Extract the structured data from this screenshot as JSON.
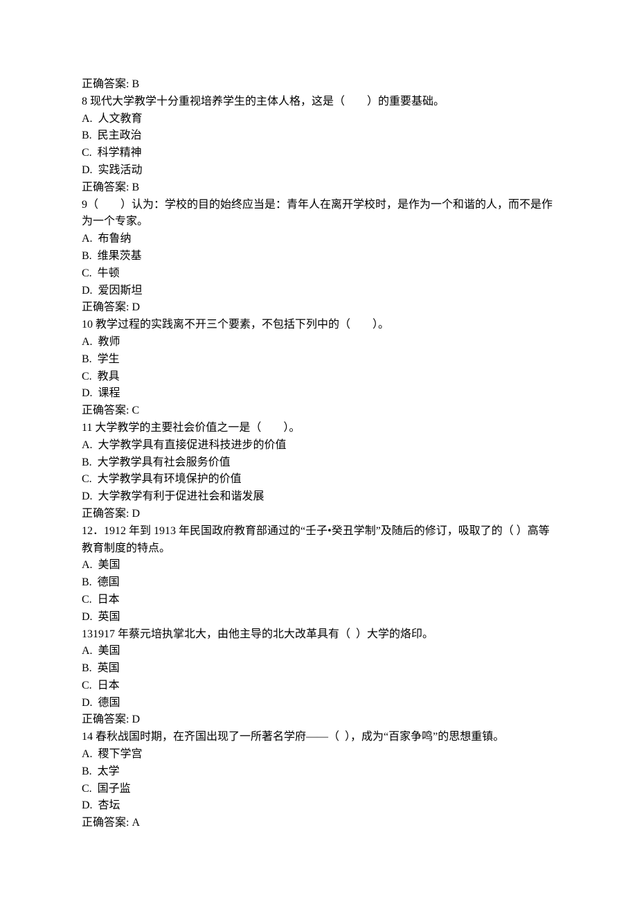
{
  "lines": [
    {
      "text": "正确答案: B"
    },
    {
      "text": "8 现代大学教学十分重视培养学生的主体人格，这是（　　）的重要基础。"
    },
    {
      "text": "A.  人文教育"
    },
    {
      "text": "B.  民主政治"
    },
    {
      "text": "C.  科学精神"
    },
    {
      "text": "D.  实践活动"
    },
    {
      "text": "正确答案: B"
    },
    {
      "text": "9（　　）认为：学校的目的始终应当是：青年人在离开学校时，是作为一个和谐的人，而不是作为一个专家。"
    },
    {
      "text": "A.  布鲁纳"
    },
    {
      "text": "B.  维果茨基"
    },
    {
      "text": "C.  牛顿"
    },
    {
      "text": "D.  爱因斯坦"
    },
    {
      "text": "正确答案: D"
    },
    {
      "text": "10 教学过程的实践离不开三个要素，不包括下列中的（　　）。"
    },
    {
      "text": "A.  教师"
    },
    {
      "text": "B.  学生"
    },
    {
      "text": "C.  教具"
    },
    {
      "text": "D.  课程"
    },
    {
      "text": "正确答案: C"
    },
    {
      "text": "11 大学教学的主要社会价值之一是（　　）。"
    },
    {
      "text": "A.  大学教学具有直接促进科技进步的价值"
    },
    {
      "text": "B.  大学教学具有社会服务价值"
    },
    {
      "text": "C.  大学教学具有环境保护的价值"
    },
    {
      "text": "D.  大学教学有利于促进社会和谐发展"
    },
    {
      "text": "正确答案: D"
    },
    {
      "text": "12．1912 年到 1913 年民国政府教育部通过的“壬子•癸丑学制”及随后的修订，吸取了的（ ）高等教育制度的特点。"
    },
    {
      "text": "A.  美国"
    },
    {
      "text": "B.  德国"
    },
    {
      "text": "C.  日本"
    },
    {
      "text": "D.  英国"
    },
    {
      "text": "131917 年蔡元培执掌北大，由他主导的北大改革具有（  ）大学的烙印。"
    },
    {
      "text": "A.  美国"
    },
    {
      "text": "B.  英国"
    },
    {
      "text": "C.  日本"
    },
    {
      "text": "D.  德国"
    },
    {
      "text": "正确答案: D"
    },
    {
      "text": "14 春秋战国时期，在齐国出现了一所著名学府——（  ），成为“百家争鸣”的思想重镇。"
    },
    {
      "text": "A.  稷下学宫"
    },
    {
      "text": "B.  太学"
    },
    {
      "text": "C.  国子监"
    },
    {
      "text": "D.  杏坛"
    },
    {
      "text": "正确答案: A"
    }
  ]
}
